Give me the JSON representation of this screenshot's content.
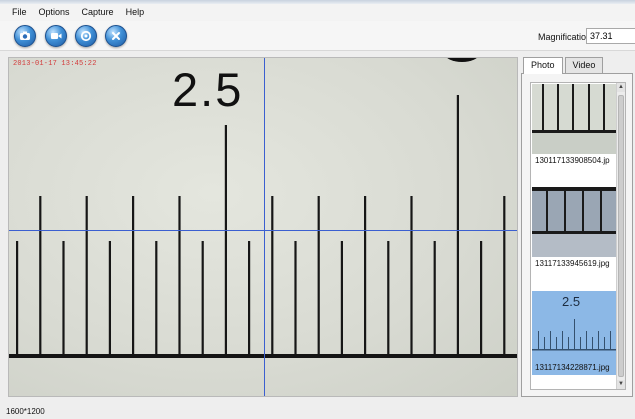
{
  "menu": [
    "File",
    "Options",
    "Capture",
    "Help"
  ],
  "toolbar": {
    "buttons": [
      {
        "name": "snapshot-button",
        "icon": "camera-icon"
      },
      {
        "name": "record-button",
        "icon": "video-camera-icon"
      },
      {
        "name": "settings-button",
        "icon": "gear-icon"
      },
      {
        "name": "close-button",
        "icon": "close-icon"
      }
    ]
  },
  "magnification": {
    "label": "Magnification:",
    "value": "37.31"
  },
  "viewer": {
    "timestamp": "2013-01-17 13:45:22",
    "ruler_label": "2.5"
  },
  "panel": {
    "tabs": [
      "Photo",
      "Video"
    ],
    "active_tab": "Photo",
    "thumbnails": [
      {
        "caption": "130117133908504.jp",
        "selected": false
      },
      {
        "caption": "13117133945619.jpg",
        "selected": false
      },
      {
        "caption": "13117134228871.jpg",
        "selected": true,
        "overlay_label": "2.5"
      }
    ]
  },
  "status": {
    "resolution": "1600*1200"
  },
  "colors": {
    "crosshair": "#3b5fd0",
    "timestamp": "#d23a3a",
    "selection": "#8cb8e6"
  }
}
